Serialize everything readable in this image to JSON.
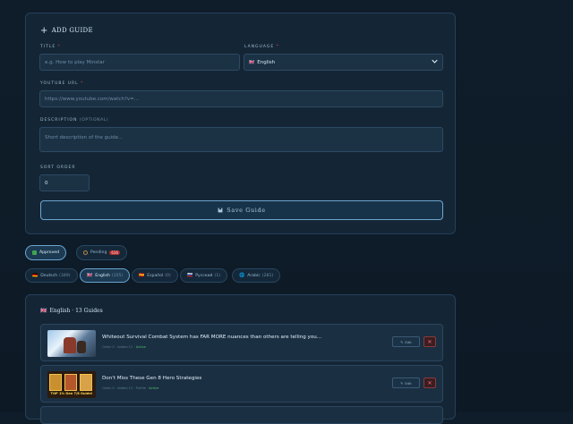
{
  "form": {
    "title": "ADD GUIDE",
    "title_label": "TITLE",
    "title_required": "*",
    "title_placeholder": "e.g. How to play Minstar",
    "language_label": "LANGUAGE",
    "language_required": "*",
    "language_value": "English",
    "language_flag": "🇬🇧",
    "youtube_label": "YOUTUBE URL",
    "youtube_required": "*",
    "youtube_placeholder": "https://www.youtube.com/watch?v=...",
    "description_label": "DESCRIPTION",
    "description_optional": "(OPTIONAL)",
    "description_placeholder": "Short description of the guide...",
    "sort_label": "SORT ORDER",
    "sort_value": "0",
    "save_label": "Save Guide",
    "save_icon": "floppy-disk-icon"
  },
  "status_filters": [
    {
      "label": "Approved",
      "icon": "checkbox-icon",
      "active": true,
      "badge": ""
    },
    {
      "label": "Pending",
      "icon": "clock-icon",
      "active": false,
      "badge": "636"
    }
  ],
  "language_filters": [
    {
      "label": "Deutsch",
      "count": "(349)",
      "flag": "🇩🇪",
      "active": false
    },
    {
      "label": "English",
      "count": "(105)",
      "flag": "🇬🇧",
      "active": true
    },
    {
      "label": "Español",
      "count": "(0)",
      "flag": "🇪🇸",
      "active": false
    },
    {
      "label": "Русский",
      "count": "(1)",
      "flag": "🇷🇺",
      "active": false
    },
    {
      "label": "Arabic",
      "count": "(281)",
      "flag": "🌐",
      "active": false
    }
  ],
  "list": {
    "title": "English · 13 Guides",
    "rows": [
      {
        "title": "Whiteout Survival Combat System has FAR MORE nuances than others are telling you...",
        "meta": "Order 0 · Added 12 ·",
        "status": "Active",
        "edit_label": "Edit",
        "delete_label": "✕"
      },
      {
        "title": "Don't Miss These Gen 8 Hero Strategies",
        "meta": "Order 0 · Added 12 · Profile ·",
        "status": "Active",
        "thumb_caption": "TOP 1% Gen 7/8 Guide!",
        "edit_label": "Edit",
        "delete_label": "✕"
      }
    ]
  },
  "colors": {
    "background": "#0f1d2a",
    "card": "#142636",
    "accent": "#6aa4d0",
    "danger": "#d64a4a",
    "success": "#4fbf6a"
  }
}
